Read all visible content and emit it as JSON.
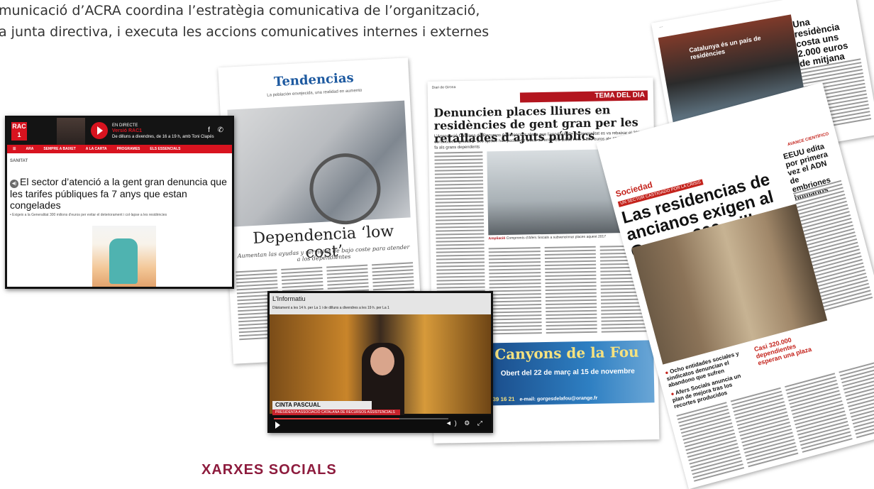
{
  "intro": {
    "line1": "municació d’ACRA coordina l’estratègia comunicativa de l’organització,",
    "line2": "a junta directiva, i executa les accions comunicatives internes i externes"
  },
  "footer": {
    "heading": "XARXES SOCIALS"
  },
  "rac1": {
    "logo": "RAC 1",
    "live_label": "EN DIRECTE",
    "program": "Versió RAC1",
    "schedule": "De dilluns a divendres, de 16 a 19 h, amb Toni Clapés",
    "nav": [
      "☰",
      "ARA",
      "SEMPRE A BAIXET",
      "A LA CARTA",
      "PROGRAMES",
      "ELS ESSENCIALS"
    ],
    "section": "SANITAT",
    "headline": "El sector d’atenció a la gent gran denuncia que les tarifes públiques fa 7 anys que estan congelades",
    "subhead": "Exigeix a la Generalitat 300 milions d'euros per evitar el deteriorament i col·lapse a les residències",
    "social_icons": "f ✆"
  },
  "tendencias": {
    "title": "Tendencias",
    "subtitle": "La población envejecida, una realidad en aumento",
    "headline": "Dependencia ‘low cost’",
    "deck": "Aumentan las ayudas y servicios de bajo coste para atender a los dependientes"
  },
  "diari": {
    "masthead": "Diari de Girona",
    "tema": "TEMA DEL DIA",
    "headline": "Denuncien places lliures en residències de gent gran per les retallades d’ajuts públics",
    "deck": "L’Associació Catalana de Recursos Assistencials alerta que l’aportació de la Generalitat es va rebaixar el 2010 i continua congelada ▶ Les ajudes han passat de situar-se entre els 1.000 i els 1.300 euros als 426 i 735, pel que fa als grans dependents",
    "caption_bold": "Ampliació",
    "caption": "Compromís d’Afers Socials a subvencionar places aquest 2017",
    "ad_title": "Canyons de la Fou",
    "ad_dates": "Obert del 22 de març al 15 de novembre",
    "ad_phone": "39 16 21",
    "ad_mail": "e-mail: gorgesdelafou@orange.fr"
  },
  "residencias": {
    "section": "Sociedad",
    "kicker": "UN SECTOR CASTIGADO POR LA CRISIS",
    "headline": "Las residencias de ancianos exigen al Govern 300 millones",
    "side_kicker": "AVANCE CIENTÍFICO",
    "side_head": "EEUU edita por primera vez el ADN de embriones humanos",
    "bullet1": "Ocho entidades sociales y sindicatos denuncian el abandono que sufren",
    "bullet2": "Afers Socials anuncia un plan de mejora tras los recortes producidos",
    "box_head": "Casi 320.000 dependientes esperan una plaza"
  },
  "una": {
    "headline": "Una residència costa uns 2.000 euros de mitjana",
    "sign": "Catalunya és un país de residències"
  },
  "tv": {
    "title": "L’Informatiu",
    "schedule": "Diàriament a les 14 h. per La 1 i de dilluns a divendres a les 19 h. per La 1",
    "name": "CINTA PASCUAL",
    "role": "PRESIDENTA ASSOCIACIÓ CATALANA DE RECURSOS ASSISTENCIALS",
    "progress_pct": 72
  }
}
